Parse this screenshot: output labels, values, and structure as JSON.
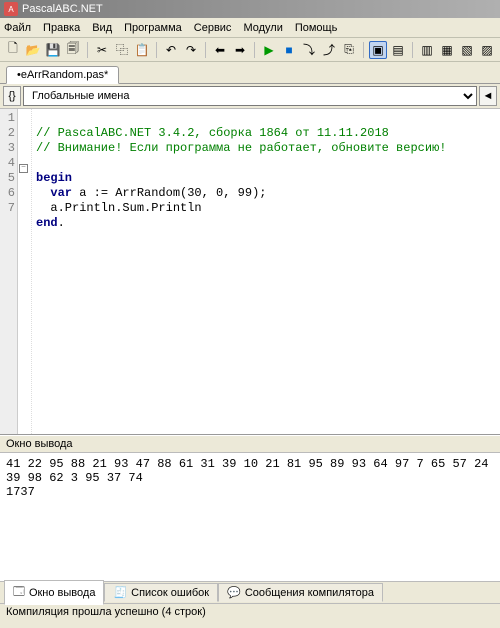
{
  "title": "PascalABC.NET",
  "menu": [
    "Файл",
    "Правка",
    "Вид",
    "Программа",
    "Сервис",
    "Модули",
    "Помощь"
  ],
  "tab": "•eArrRandom.pas*",
  "combo": {
    "globals_btn": "{}",
    "selected": "Глобальные имена",
    "back_icon": "◄"
  },
  "gutter": [
    "1",
    "2",
    "3",
    "4",
    "5",
    "6",
    "7"
  ],
  "code": {
    "l1_cmt": "// PascalABC.NET 3.4.2, сборка 1864 от 11.11.2018",
    "l2_cmt": "// Внимание! Если программа не работает, обновите версию!",
    "l3": "",
    "l4_kw": "begin",
    "l5a": "  ",
    "l5_kw": "var",
    "l5b": " a := ArrRandom(",
    "l5_n1": "30",
    "l5c": ", ",
    "l5_n2": "0",
    "l5d": ", ",
    "l5_n3": "99",
    "l5e": ");",
    "l6": "  a.Println.Sum.Println",
    "l7_kw": "end",
    "l7b": "."
  },
  "output_header": "Окно вывода",
  "output_text": "41 22 95 88 21 93 47 88 61 31 39 10 21 81 95 89 93 64 97 7 65 57 24 39 98 62 3 95 37 74\n1737",
  "bottom_tabs": [
    {
      "icon": "🗔",
      "label": "Окно вывода"
    },
    {
      "icon": "🧾",
      "label": "Список ошибок"
    },
    {
      "icon": "💬",
      "label": "Сообщения компилятора"
    }
  ],
  "status": "Компиляция прошла успешно (4 строк)",
  "toolbar_icons": {
    "new": "🗋",
    "open": "📂",
    "save": "💾",
    "saveall": "🗐",
    "cut": "✂",
    "copy": "⿻",
    "paste": "📋",
    "undo": "↶",
    "redo": "↷",
    "nav_back": "⬅",
    "nav_fwd": "➡",
    "run": "▶",
    "stop": "■",
    "step_into": "⤵",
    "step_over": "⤴",
    "compile": "⎘",
    "view1": "▣",
    "view2": "▤",
    "view3": "▥",
    "view4": "▦",
    "view5": "▧",
    "view6": "▨"
  }
}
